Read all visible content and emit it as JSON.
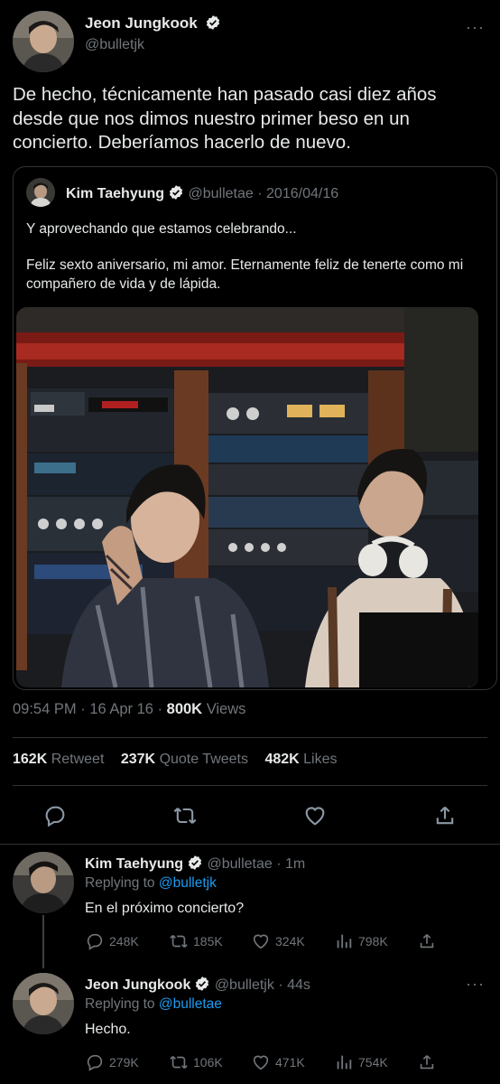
{
  "main_tweet": {
    "name": "Jeon Jungkook",
    "handle": "@bulletjk",
    "text": "De hecho, técnicamente han pasado casi diez años desde que nos dimos nuestro primer beso en un concierto. Deberíamos hacerlo de nuevo.",
    "quote": {
      "name": "Kim Taehyung",
      "handle": "@bulletae",
      "date": "2016/04/16",
      "line1": "Y aprovechando que estamos celebrando...",
      "line2": "Feliz sexto aniversario, mi amor. Eternamente feliz de tenerte como mi compañero de vida y de lápida."
    },
    "time": "09:54 PM",
    "date": "16 Apr 16",
    "views_count": "800K",
    "views_label": "Views",
    "retweets_count": "162K",
    "retweets_label": "Retweet",
    "quotes_count": "237K",
    "quotes_label": "Quote Tweets",
    "likes_count": "482K",
    "likes_label": "Likes"
  },
  "replies": [
    {
      "name": "Kim Taehyung",
      "handle": "@bulletae",
      "age": "1m",
      "replying_prefix": "Replying to",
      "replying_to": "@bulletjk",
      "text": "En el próximo concierto?",
      "comments": "248K",
      "retweets": "185K",
      "likes": "324K",
      "views": "798K"
    },
    {
      "name": "Jeon Jungkook",
      "handle": "@bulletjk",
      "age": "44s",
      "replying_prefix": "Replying to",
      "replying_to": "@bulletae",
      "text": "Hecho.",
      "comments": "279K",
      "retweets": "106K",
      "likes": "471K",
      "views": "754K"
    }
  ],
  "icons": [
    "verified-badge-icon",
    "more-icon",
    "reply-icon",
    "retweet-icon",
    "like-icon",
    "share-icon",
    "views-icon"
  ],
  "colors": {
    "background": "#000000",
    "text": "#e7e9ea",
    "secondary": "#71767b",
    "accent": "#1d9bf0",
    "border": "#2f3336"
  }
}
